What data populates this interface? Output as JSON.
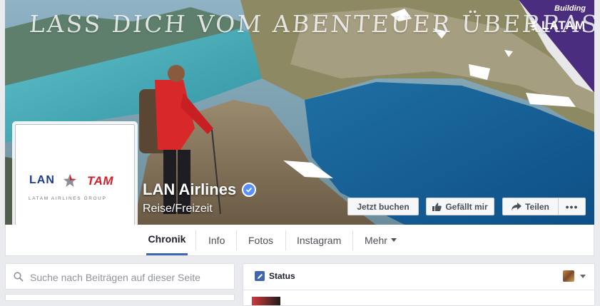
{
  "cover": {
    "headline": "LASS DICH VOM ABENTEUER ÜBERRASCHEN",
    "corner_tag": "Building",
    "corner_brand": "LATAM",
    "accent": "#4a2d7f"
  },
  "profile_picture": {
    "brand_left": "LAN",
    "brand_right": "TAM",
    "tagline": "LATAM AIRLINES GROUP"
  },
  "page": {
    "name": "LAN Airlines",
    "category": "Reise/Freizeit",
    "verified_icon": "verified-badge-icon"
  },
  "actions": {
    "book": "Jetzt buchen",
    "like": "Gefällt mir",
    "share": "Teilen",
    "more": "•••"
  },
  "tabs": [
    {
      "label": "Chronik",
      "active": true
    },
    {
      "label": "Info"
    },
    {
      "label": "Fotos"
    },
    {
      "label": "Instagram"
    },
    {
      "label": "Mehr"
    }
  ],
  "search": {
    "placeholder": "Suche nach Beiträgen auf dieser Seite",
    "value": ""
  },
  "composer": {
    "status_label": "Status"
  },
  "colors": {
    "facebook_blue": "#4267b2",
    "verified_blue": "#5890ff",
    "lan_blue": "#1f3c88",
    "tam_red": "#d4202b"
  }
}
